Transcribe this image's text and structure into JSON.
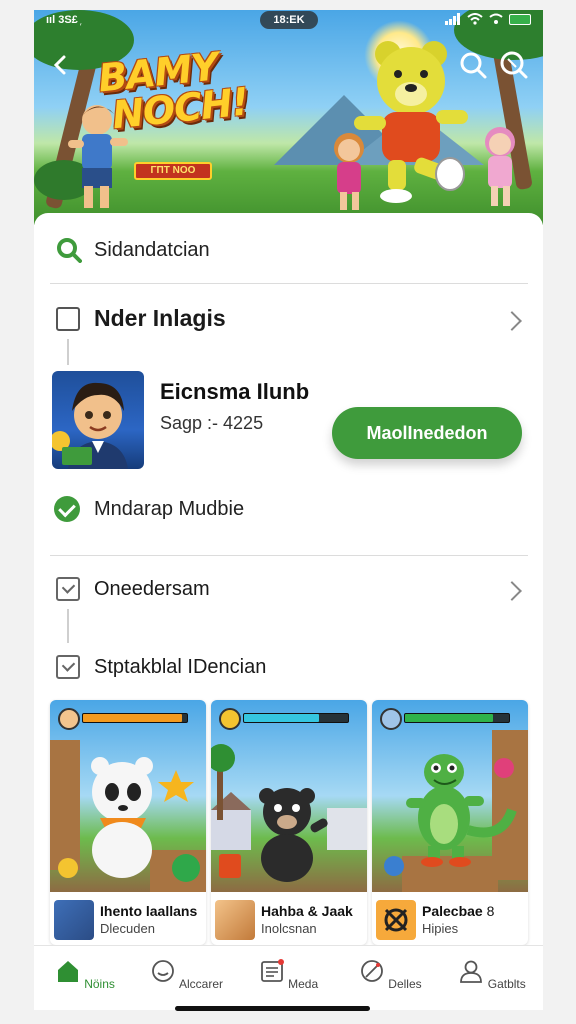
{
  "status_bar": {
    "left": "ııl 3S£ ᷊",
    "time": "18:EK"
  },
  "hero": {
    "title_line1": "BAMY",
    "title_line2": "NOCH!",
    "cta": "ΓΠΤ ΝΟΟ"
  },
  "search": {
    "label": "Sidandatcian"
  },
  "section": {
    "title": "Nder Inlagis"
  },
  "app": {
    "title": "Eicnsma Ilunb",
    "subtitle": "Sagp :- 4225",
    "install_label": "MaolInededon"
  },
  "verified": {
    "label": "Mndarap Mudbie"
  },
  "options": [
    {
      "label": "Oneedersam"
    },
    {
      "label": "Stptakblal IDencian"
    }
  ],
  "games": [
    {
      "name": "Ihento laallans",
      "sub": "Dlecuden",
      "bar_fill": 0.95,
      "bar_color": "#f39a1f"
    },
    {
      "name": "Hahba & Jaak",
      "sub": "Inolcsnan",
      "bar_fill": 0.72,
      "bar_color": "#35c6e0"
    },
    {
      "name": "Palecbae",
      "name_suffix": "8",
      "sub": "Hipies",
      "bar_fill": 0.85,
      "bar_color": "#2fb24a"
    }
  ],
  "nav": [
    {
      "label": "Nöins",
      "icon": "home-icon",
      "active": true
    },
    {
      "label": "Alccarer",
      "icon": "clock-icon",
      "active": false
    },
    {
      "label": "Meda",
      "icon": "news-icon",
      "active": false
    },
    {
      "label": "Delles",
      "icon": "pen-icon",
      "active": false
    },
    {
      "label": "Gatblts",
      "icon": "profile-icon",
      "active": false
    }
  ],
  "colors": {
    "accent": "#3f9b3c",
    "nav_active": "#2f8f33",
    "title_art": "#ffcf2a",
    "cta_red": "#c2331f"
  }
}
